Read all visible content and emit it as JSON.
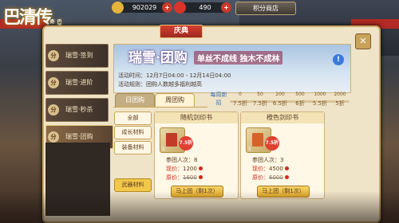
{
  "game_logo": {
    "title": "巴清传",
    "subtitle": "巴清传奇"
  },
  "currencies": [
    {
      "icon": "coin-icon",
      "value": "902029",
      "color": "#e6b43a"
    },
    {
      "icon": "gem-icon",
      "value": "490",
      "color": "#d9342a"
    }
  ],
  "shop_button": "积分商店",
  "panel": {
    "title": "庆典",
    "close": "✕"
  },
  "nav": [
    {
      "tag": "分",
      "label": "瑞雪·签到"
    },
    {
      "tag": "分",
      "label": "瑞雪·进阶"
    },
    {
      "tag": "分",
      "label": "瑞雪·秒杀"
    },
    {
      "tag": "分",
      "label": "瑞雪·团购",
      "active": true
    }
  ],
  "hero": {
    "title": "瑞雪·团购",
    "slogan": "单丝不成线  独木不成林",
    "info_icon": "?",
    "warn_icon": "!",
    "time_label": "活动时间：12月7日04:00 - 12月14日04:00",
    "rule_label": "活动规则：团购人数越多福利越高"
  },
  "tabs": [
    {
      "label": "日团购",
      "active": false
    },
    {
      "label": "周团购",
      "active": true
    }
  ],
  "discount": {
    "header": "每周新招",
    "tiers": [
      {
        "count": "0",
        "rate": "7.5折"
      },
      {
        "count": "50",
        "rate": "7.5折"
      },
      {
        "count": "200",
        "rate": "6.5折"
      },
      {
        "count": "500",
        "rate": "6折"
      },
      {
        "count": "1000",
        "rate": "5.5折"
      },
      {
        "count": "2000",
        "rate": "5折"
      }
    ]
  },
  "categories": [
    {
      "label": "全部"
    },
    {
      "label": "成长材料"
    },
    {
      "label": "装备材料"
    },
    {
      "label": "武器材料",
      "active": true
    }
  ],
  "cards": [
    {
      "name": "随机剑印书",
      "count": "5",
      "discount": "7.5折",
      "participants_label": "参团人次：",
      "participants": "8",
      "now_label": "现价：",
      "now_price": "1200",
      "orig_label": "原价：",
      "orig_price": "1600",
      "join": "马上团（剩1次）"
    },
    {
      "name": "橙色剑印书",
      "count": "5",
      "discount": "7.5折",
      "participants_label": "参团人次：",
      "participants": "3",
      "now_label": "现价：",
      "now_price": "4500",
      "orig_label": "原价：",
      "orig_price": "6000",
      "join": "马上团（剩1次）"
    }
  ]
}
